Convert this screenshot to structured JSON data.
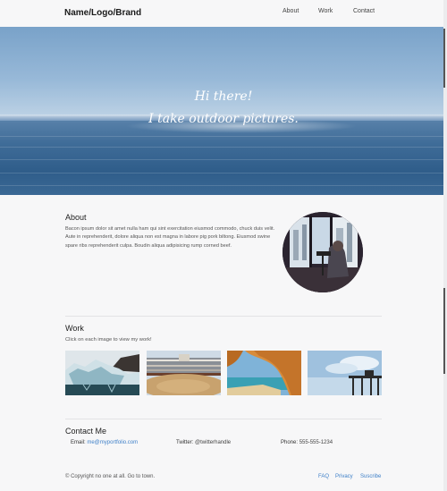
{
  "header": {
    "brand": "Name/Logo/Brand",
    "nav": [
      "About",
      "Work",
      "Contact"
    ]
  },
  "hero": {
    "line1": "Hi there!",
    "line2": "I take outdoor pictures."
  },
  "about": {
    "title": "About",
    "text": "Bacon ipsum dolor sit amet nulla ham qui sint exercitation eiusmod commodo, chuck duis velit. Aute in reprehenderit, dolore aliqua non est magna in labore pig pork biltong. Eiusmod swine spare ribs reprehenderit culpa. Boudin aliqua adipisicing rump corned beef."
  },
  "work": {
    "title": "Work",
    "subtitle": "Click on each image to view my work!"
  },
  "contact": {
    "title": "Contact Me",
    "email_label": "Email:",
    "email_value": "me@myportfolio.com",
    "twitter_label": "Twitter:",
    "twitter_value": "@twitterhandle",
    "phone_label": "Phone:",
    "phone_value": "555-555-1234"
  },
  "footer": {
    "copyright": "© Copyright no one at all. Go to town.",
    "links": [
      "FAQ",
      "Privacy",
      "Suscribe"
    ]
  },
  "colors": {
    "link": "#3f80c8",
    "background": "#f7f7f8"
  }
}
